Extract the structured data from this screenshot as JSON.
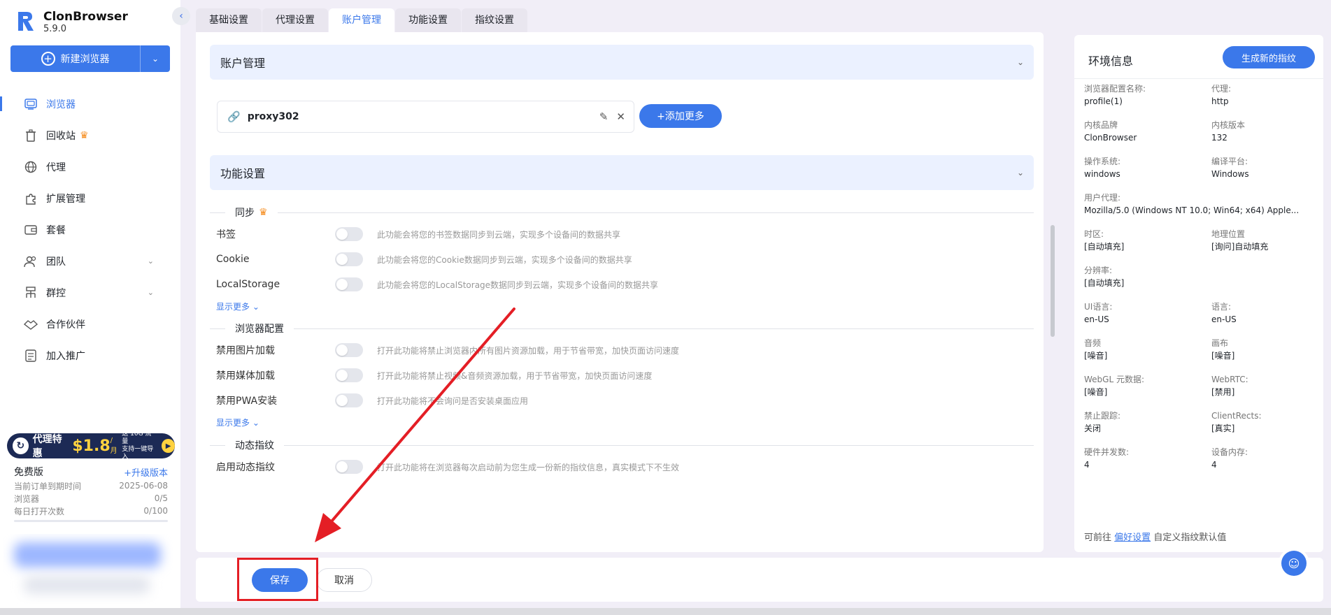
{
  "app": {
    "name": "ClonBrowser",
    "version": "5.9.0"
  },
  "sidebar": {
    "new_browser_label": "新建浏览器",
    "items": [
      {
        "label": "浏览器",
        "icon": "browser-icon",
        "active": true
      },
      {
        "label": "回收站",
        "icon": "trash-icon",
        "crown": true
      },
      {
        "label": "代理",
        "icon": "globe-icon"
      },
      {
        "label": "扩展管理",
        "icon": "puzzle-icon"
      },
      {
        "label": "套餐",
        "icon": "wallet-icon"
      },
      {
        "label": "团队",
        "icon": "team-icon",
        "expandable": true
      },
      {
        "label": "群控",
        "icon": "sitemap-icon",
        "expandable": true
      },
      {
        "label": "合作伙伴",
        "icon": "handshake-icon"
      },
      {
        "label": "加入推广",
        "icon": "promo-icon"
      }
    ],
    "promo": {
      "text": "代理特惠",
      "price": "$1.8",
      "unit": "/月",
      "sub1": "送 10G 流量",
      "sub2": "支持一键导入"
    },
    "plan": {
      "name": "免费版",
      "upgrade": "+升级版本",
      "rows": [
        {
          "label": "当前订单到期时间",
          "value": "2025-06-08"
        },
        {
          "label": "浏览器",
          "value": "0/5"
        },
        {
          "label": "每日打开次数",
          "value": "0/100"
        }
      ]
    }
  },
  "tabs": [
    "基础设置",
    "代理设置",
    "账户管理",
    "功能设置",
    "指纹设置"
  ],
  "active_tab": "账户管理",
  "account": {
    "section_title": "账户管理",
    "proxy_name": "proxy302",
    "add_more": "+添加更多"
  },
  "features": {
    "section_title": "功能设置",
    "groups": [
      {
        "title": "同步",
        "items": [
          {
            "label": "书签",
            "desc": "此功能会将您的书签数据同步到云端，实现多个设备间的数据共享"
          },
          {
            "label": "Cookie",
            "desc": "此功能会将您的Cookie数据同步到云端，实现多个设备间的数据共享"
          },
          {
            "label": "LocalStorage",
            "desc": "此功能会将您的LocalStorage数据同步到云端，实现多个设备间的数据共享"
          }
        ],
        "show_more": "显示更多"
      },
      {
        "title": "浏览器配置",
        "items": [
          {
            "label": "禁用图片加载",
            "desc": "打开此功能将禁止浏览器内所有图片资源加载，用于节省带宽，加快页面访问速度"
          },
          {
            "label": "禁用媒体加载",
            "desc": "打开此功能将禁止视频&音频资源加载，用于节省带宽，加快页面访问速度"
          },
          {
            "label": "禁用PWA安装",
            "desc": "打开此功能将不会询问是否安装桌面应用"
          }
        ],
        "show_more": "显示更多"
      },
      {
        "title": "动态指纹",
        "items": [
          {
            "label": "启用动态指纹",
            "desc": "打开此功能将在浏览器每次启动前为您生成一份新的指纹信息，真实模式下不生效"
          }
        ]
      }
    ]
  },
  "footer": {
    "save": "保存",
    "cancel": "取消"
  },
  "env": {
    "title": "环境信息",
    "generate": "生成新的指纹",
    "fields": [
      {
        "label": "浏览器配置名称:",
        "value": "profile(1)"
      },
      {
        "label": "代理:",
        "value": "http"
      },
      {
        "label": "内核品牌",
        "value": "ClonBrowser"
      },
      {
        "label": "内核版本",
        "value": "132"
      },
      {
        "label": "操作系统:",
        "value": "windows"
      },
      {
        "label": "编译平台:",
        "value": "Windows"
      },
      {
        "label": "用户代理:",
        "value": "Mozilla/5.0 (Windows NT 10.0; Win64; x64) Apple..."
      },
      {
        "label": "时区:",
        "value": "[自动填充]"
      },
      {
        "label": "地理位置",
        "value": "[询问]自动填充"
      },
      {
        "label": "分辨率:",
        "value": "[自动填充]"
      },
      {
        "label": "UI语言:",
        "value": "en-US"
      },
      {
        "label": "语言:",
        "value": "en-US"
      },
      {
        "label": "音频",
        "value": "[噪音]"
      },
      {
        "label": "画布",
        "value": "[噪音]"
      },
      {
        "label": "WebGL 元数据:",
        "value": "[噪音]"
      },
      {
        "label": "WebRTC:",
        "value": "[禁用]"
      },
      {
        "label": "禁止跟踪:",
        "value": "关闭"
      },
      {
        "label": "ClientRects:",
        "value": "[真实]"
      },
      {
        "label": "硬件并发数:",
        "value": "4"
      },
      {
        "label": "设备内存:",
        "value": "4"
      }
    ],
    "footer_prefix": "可前往",
    "footer_link": "偏好设置",
    "footer_suffix": "自定义指纹默认值"
  },
  "colors": {
    "accent": "#3b78ea",
    "annotation": "#e41e25",
    "crown": "#f58c1e"
  }
}
